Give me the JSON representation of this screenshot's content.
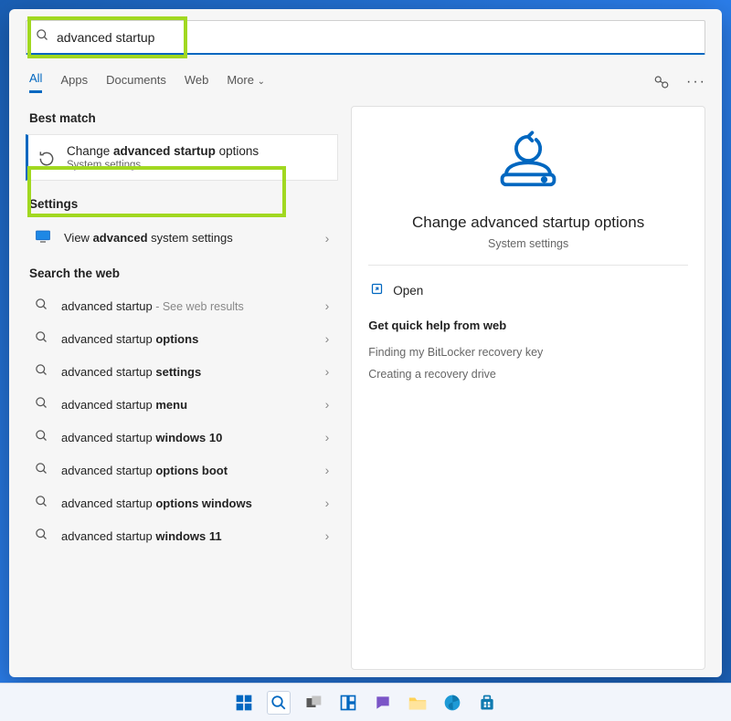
{
  "search": {
    "query": "advanced startup"
  },
  "tabs": {
    "all": "All",
    "apps": "Apps",
    "documents": "Documents",
    "web": "Web",
    "more": "More"
  },
  "sections": {
    "best_match": "Best match",
    "settings": "Settings",
    "search_web": "Search the web"
  },
  "best_match": {
    "title_pre": "Change ",
    "title_bold": "advanced startup",
    "title_post": " options",
    "subtitle": "System settings"
  },
  "settings_item": {
    "pre": "View ",
    "bold": "advanced",
    "post": " system settings"
  },
  "web_results": [
    {
      "pre": "advanced startup",
      "bold": "",
      "post": "",
      "suffix": " - See web results"
    },
    {
      "pre": "advanced startup ",
      "bold": "options",
      "post": ""
    },
    {
      "pre": "advanced startup ",
      "bold": "settings",
      "post": ""
    },
    {
      "pre": "advanced startup ",
      "bold": "menu",
      "post": ""
    },
    {
      "pre": "advanced startup ",
      "bold": "windows 10",
      "post": ""
    },
    {
      "pre": "advanced startup ",
      "bold": "options boot",
      "post": ""
    },
    {
      "pre": "advanced startup ",
      "bold": "options windows",
      "post": ""
    },
    {
      "pre": "advanced startup ",
      "bold": "windows 11",
      "post": ""
    }
  ],
  "detail": {
    "title": "Change advanced startup options",
    "subtitle": "System settings",
    "open": "Open",
    "help_header": "Get quick help from web",
    "help_items": [
      "Finding my BitLocker recovery key",
      "Creating a recovery drive"
    ]
  },
  "colors": {
    "accent": "#0067c0",
    "highlight": "#a1d820"
  }
}
